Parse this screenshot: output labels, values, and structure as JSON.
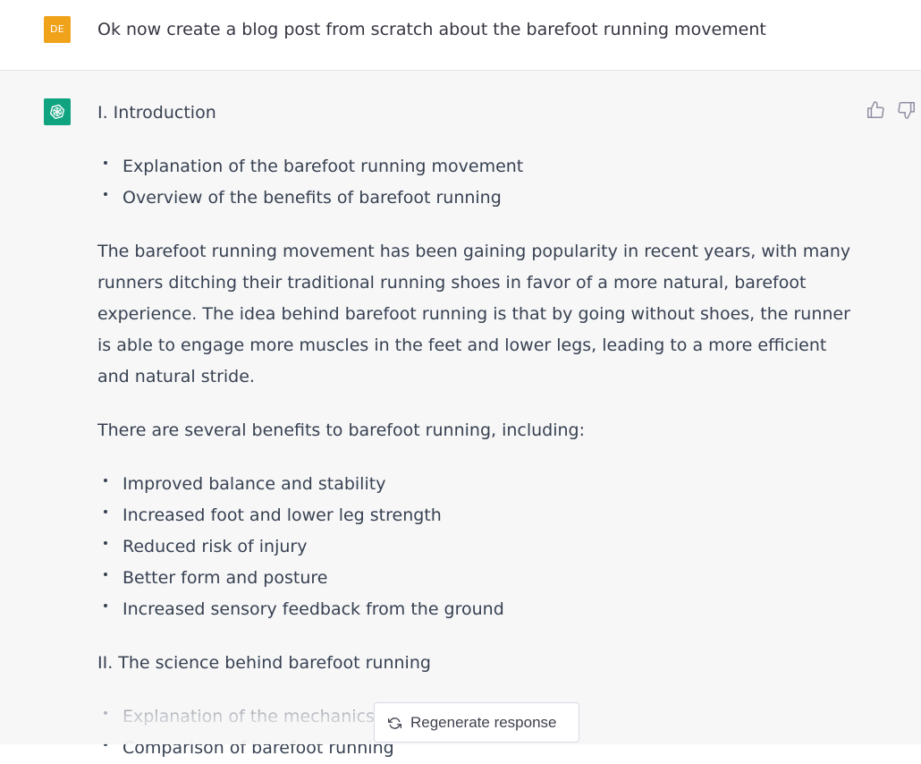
{
  "user_message": {
    "avatar_initials": "DE",
    "text": "Ok now create a blog post from scratch about the barefoot running movement"
  },
  "assistant_message": {
    "section1_heading": "I. Introduction",
    "outline_items": [
      "Explanation of the barefoot running movement",
      "Overview of the benefits of barefoot running"
    ],
    "paragraph1": "The barefoot running movement has been gaining popularity in recent years, with many runners ditching their traditional running shoes in favor of a more natural, barefoot experience. The idea behind barefoot running is that by going without shoes, the runner is able to engage more muscles in the feet and lower legs, leading to a more efficient and natural stride.",
    "paragraph2": "There are several benefits to barefoot running, including:",
    "benefits": [
      "Improved balance and stability",
      "Increased foot and lower leg strength",
      "Reduced risk of injury",
      "Better form and posture",
      "Increased sensory feedback from the ground"
    ],
    "section2_heading": "II. The science behind barefoot running",
    "section2_items": [
      "Explanation of the mechanics",
      "Comparison of barefoot running"
    ]
  },
  "controls": {
    "regenerate_label": "Regenerate response",
    "thumbs_up": "thumbs-up-icon",
    "thumbs_down": "thumbs-down-icon"
  },
  "colors": {
    "user_avatar": "#f0a21b",
    "bot_avatar": "#10a37f",
    "assistant_bg": "#f7f7f8",
    "text": "#374151"
  }
}
